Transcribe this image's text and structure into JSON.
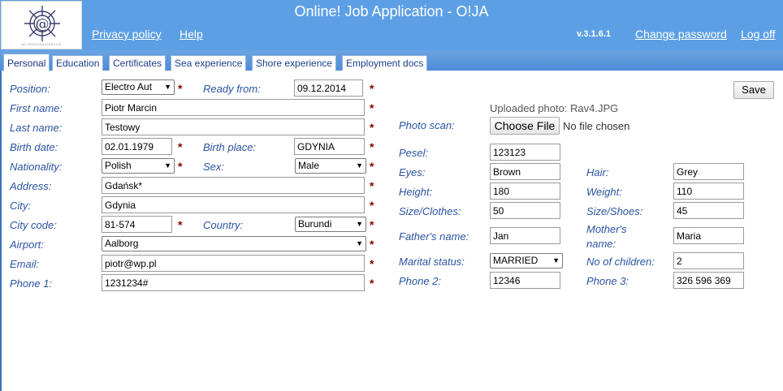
{
  "header": {
    "title": "Online! Job Application - O!JA",
    "logo_caption": "AD PERSONALSERVICE",
    "logo_icon": "anchor-wheel-at-logo",
    "links": {
      "privacy": "Privacy policy",
      "help": "Help",
      "change_password": "Change password",
      "logoff": "Log off"
    },
    "version": "v.3.1.6.1",
    "background": "#5c9fe4"
  },
  "tabs": [
    {
      "label": "Personal",
      "active": true
    },
    {
      "label": "Education"
    },
    {
      "label": "Certificates"
    },
    {
      "label": "Sea experience"
    },
    {
      "label": "Shore experience"
    },
    {
      "label": "Employment docs"
    }
  ],
  "required_mark": "*",
  "form": {
    "position": {
      "label": "Position:",
      "value": "Electro Aut"
    },
    "ready_from": {
      "label": "Ready from:",
      "value": "09.12.2014"
    },
    "first_name": {
      "label": "First name:",
      "value": "Piotr Marcin"
    },
    "last_name": {
      "label": "Last name:",
      "value": "Testowy"
    },
    "birth_date": {
      "label": "Birth date:",
      "value": "02.01.1979"
    },
    "birth_place": {
      "label": "Birth place:",
      "value": "GDYNIA"
    },
    "nationality": {
      "label": "Nationality:",
      "value": "Polish"
    },
    "sex": {
      "label": "Sex:",
      "value": "Male"
    },
    "address": {
      "label": "Address:",
      "value": "Gdańsk*"
    },
    "city": {
      "label": "City:",
      "value": "Gdynia"
    },
    "city_code": {
      "label": "City code:",
      "value": "81-574"
    },
    "country": {
      "label": "Country:",
      "value": "Burundi"
    },
    "airport": {
      "label": "Airport:",
      "value": "Aalborg"
    },
    "email": {
      "label": "Email:",
      "value": "piotr@wp.pl"
    },
    "phone1": {
      "label": "Phone 1:",
      "value": "1231234#"
    }
  },
  "right": {
    "save": "Save",
    "uploaded_photo": "Uploaded photo: Rav4.JPG",
    "photo_scan": {
      "label": "Photo scan:",
      "button": "Choose File",
      "status": "No file chosen"
    },
    "pesel": {
      "label": "Pesel:",
      "value": "123123"
    },
    "eyes": {
      "label": "Eyes:",
      "value": "Brown"
    },
    "hair": {
      "label": "Hair:",
      "value": "Grey"
    },
    "height": {
      "label": "Height:",
      "value": "180"
    },
    "weight": {
      "label": "Weight:",
      "value": "110"
    },
    "size_clothes": {
      "label": "Size/Clothes:",
      "value": "50"
    },
    "size_shoes": {
      "label": "Size/Shoes:",
      "value": "45"
    },
    "fathers_name": {
      "label": "Father's name:",
      "value": "Jan"
    },
    "mothers_name": {
      "label_line1": "Mother's",
      "label_line2": "name:",
      "value": "Maria"
    },
    "marital_status": {
      "label": "Marital status:",
      "value": "MARRIED"
    },
    "children": {
      "label": "No of children:",
      "value": "2"
    },
    "phone2": {
      "label": "Phone 2:",
      "value": "12346"
    },
    "phone3": {
      "label": "Phone 3:",
      "value": "326 596 369"
    }
  },
  "colors": {
    "label": "#2a53a3",
    "required": "#8b0000",
    "tabbar": "#5a96dc"
  }
}
